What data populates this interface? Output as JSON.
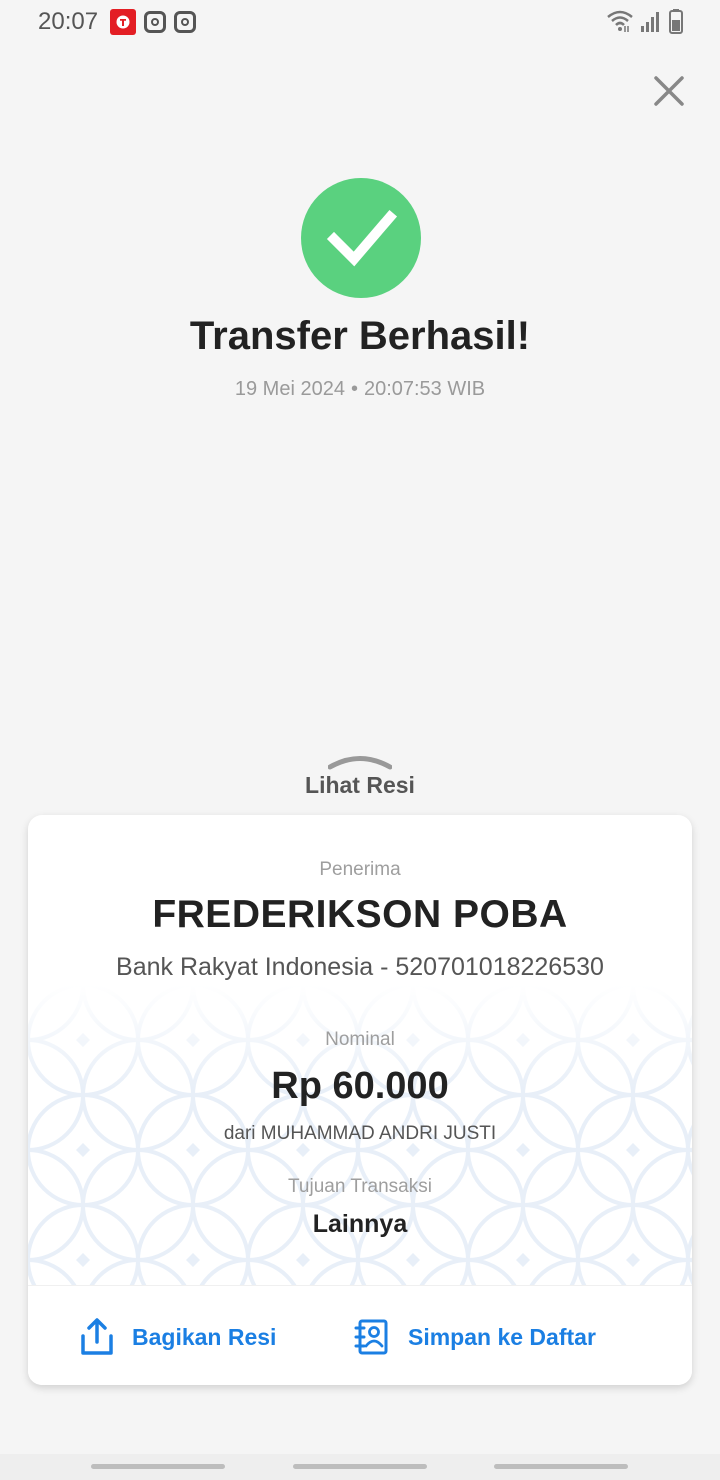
{
  "status_bar": {
    "time": "20:07",
    "left_icons": [
      "telkomsel-icon",
      "instagram-icon",
      "instagram-icon"
    ],
    "right_icons": [
      "wifi-icon",
      "signal-icon",
      "battery-icon"
    ]
  },
  "header": {
    "close_icon": "close-icon"
  },
  "success": {
    "title": "Transfer Berhasil!",
    "date": "19 Mei 2024",
    "separator": "•",
    "time": "20:07:53 WIB",
    "color": "#5ad17f"
  },
  "receipt_toggle": {
    "label": "Lihat Resi"
  },
  "receipt": {
    "recipient_label": "Penerima",
    "recipient_name": "FREDERIKSON POBA",
    "recipient_bank": "Bank Rakyat Indonesia - 520701018226530",
    "amount_label": "Nominal",
    "amount": "Rp 60.000",
    "sender": "dari MUHAMMAD ANDRI JUSTI",
    "purpose_label": "Tujuan Transaksi",
    "purpose": "Lainnya"
  },
  "actions": {
    "share_label": "Bagikan Resi",
    "save_label": "Simpan ke Daftar",
    "accent_color": "#1b7fe3"
  }
}
